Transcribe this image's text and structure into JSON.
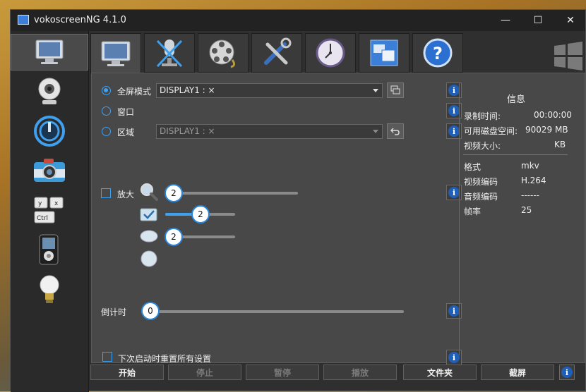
{
  "window": {
    "title": "vokoscreenNG 4.1.0",
    "minimize": "—",
    "maximize": "☐",
    "close": "✕"
  },
  "sidebar": {
    "items": [
      {
        "name": "monitor",
        "selected": true
      },
      {
        "name": "webcam"
      },
      {
        "name": "logo"
      },
      {
        "name": "camera"
      },
      {
        "name": "keyboard"
      },
      {
        "name": "media-player"
      },
      {
        "name": "lightbulb"
      }
    ]
  },
  "tabs": [
    "screen",
    "audio",
    "codec",
    "tools",
    "timer",
    "window",
    "help"
  ],
  "screen": {
    "fullscreen_label": "全屏模式",
    "window_label": "窗口",
    "area_label": "区域",
    "display_value": "DISPLAY1 : ×",
    "area_display_value": "DISPLAY1 : ×",
    "magnifier_label": "放大",
    "magnifier_value": "2",
    "slider2_value": "2",
    "slider3_value": "2",
    "countdown_label": "倒计时",
    "countdown_value": "0",
    "reset_label": "下次启动时重置所有设置"
  },
  "info": {
    "heading": "信息",
    "rows": [
      {
        "label": "录制时间:",
        "value": "00:00:00"
      },
      {
        "label": "可用磁盘空间:",
        "value": "90029  MB"
      },
      {
        "label": "视频大小:",
        "value": "KB"
      }
    ],
    "format_rows": [
      {
        "label": "格式",
        "value": "mkv"
      },
      {
        "label": "视频编码",
        "value": "H.264"
      },
      {
        "label": "音频编码",
        "value": "------"
      },
      {
        "label": "帧率",
        "value": "25"
      }
    ]
  },
  "bottom": {
    "start": "开始",
    "stop": "停止",
    "pause": "暂停",
    "play": "播放",
    "folder": "文件夹",
    "screenshot": "截屏"
  },
  "colors": {
    "accent": "#3fa0f0",
    "info_blue": "#1f5fb8"
  }
}
